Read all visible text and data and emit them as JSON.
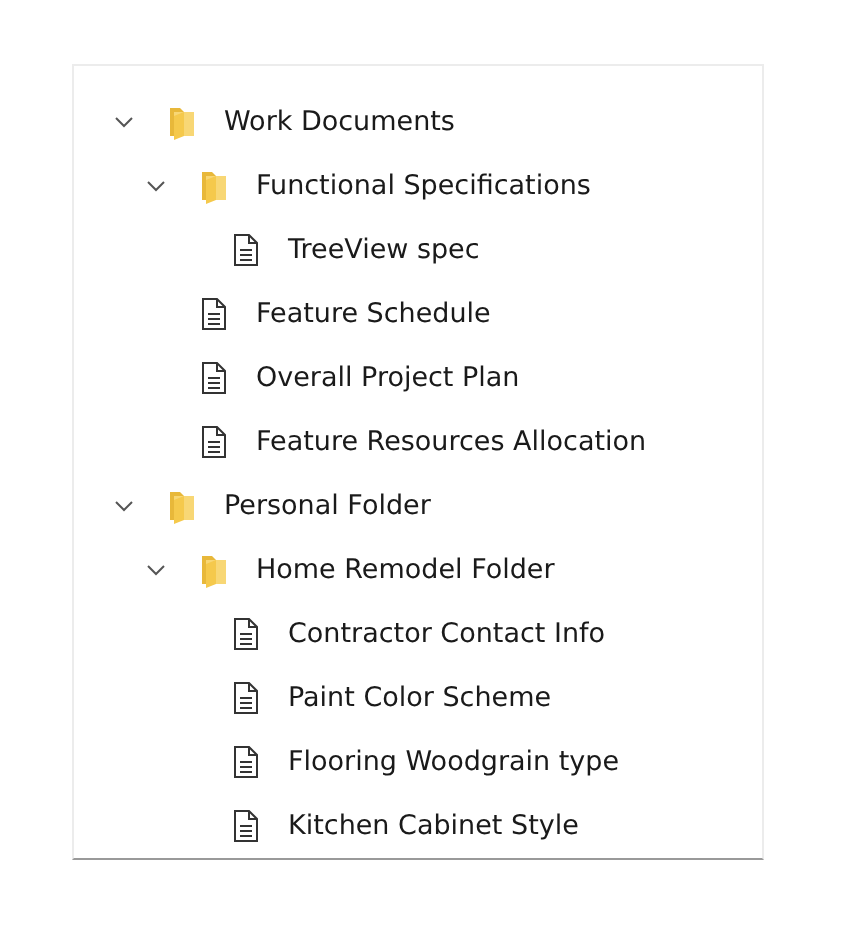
{
  "tree": [
    {
      "kind": "folder",
      "label": "Work Documents",
      "expanded": true,
      "children": [
        {
          "kind": "folder",
          "label": "Functional Specifications",
          "expanded": true,
          "children": [
            {
              "kind": "file",
              "label": "TreeView spec"
            }
          ]
        },
        {
          "kind": "file",
          "label": "Feature Schedule"
        },
        {
          "kind": "file",
          "label": "Overall Project Plan"
        },
        {
          "kind": "file",
          "label": "Feature Resources Allocation"
        }
      ]
    },
    {
      "kind": "folder",
      "label": "Personal Folder",
      "expanded": true,
      "children": [
        {
          "kind": "folder",
          "label": "Home Remodel Folder",
          "expanded": true,
          "children": [
            {
              "kind": "file",
              "label": "Contractor Contact Info"
            },
            {
              "kind": "file",
              "label": "Paint Color Scheme"
            },
            {
              "kind": "file",
              "label": "Flooring Woodgrain type"
            },
            {
              "kind": "file",
              "label": "Kitchen Cabinet Style"
            }
          ]
        }
      ]
    }
  ]
}
